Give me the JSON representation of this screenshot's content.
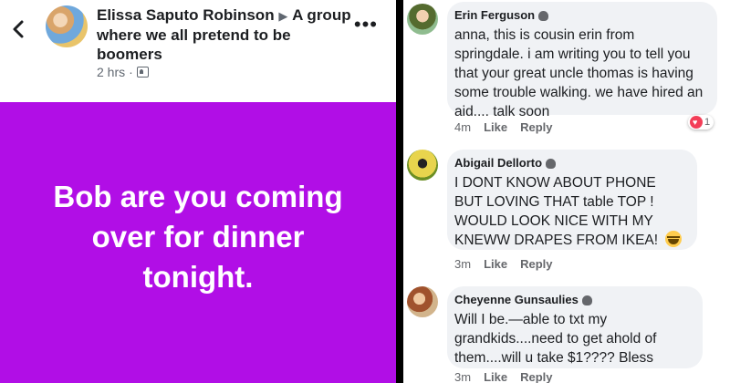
{
  "post": {
    "author": "Elissa Saputo Robinson",
    "arrow": "▶",
    "group": "A group where we all pretend to be boomers",
    "time": "2 hrs",
    "separator": "·",
    "status_text": "Bob are you coming over for dinner tonight.",
    "background_color": "#b10ee6"
  },
  "comments": [
    {
      "name": "Erin Ferguson",
      "text": "anna, this is cousin erin from springdale. i am writing you to tell you that your great uncle thomas is having some trouble walking. we have hired an aid.... talk soon",
      "time": "4m",
      "like": "Like",
      "reply": "Reply",
      "reaction_count": "1"
    },
    {
      "name": "Abigail Dellorto",
      "text": "I DONT KNOW ABOUT PHONE BUT LOVING THAT table TOP ! WOULD LOOK NICE WITH MY KNEWW DRAPES FROM IKEA!",
      "time": "3m",
      "like": "Like",
      "reply": "Reply"
    },
    {
      "name": "Cheyenne Gunsaulies",
      "text": "Will I be.—able to txt my grandkids....need to get ahold of them....will u take $1???? Bless",
      "time": "3m",
      "like": "Like",
      "reply": "Reply"
    }
  ]
}
